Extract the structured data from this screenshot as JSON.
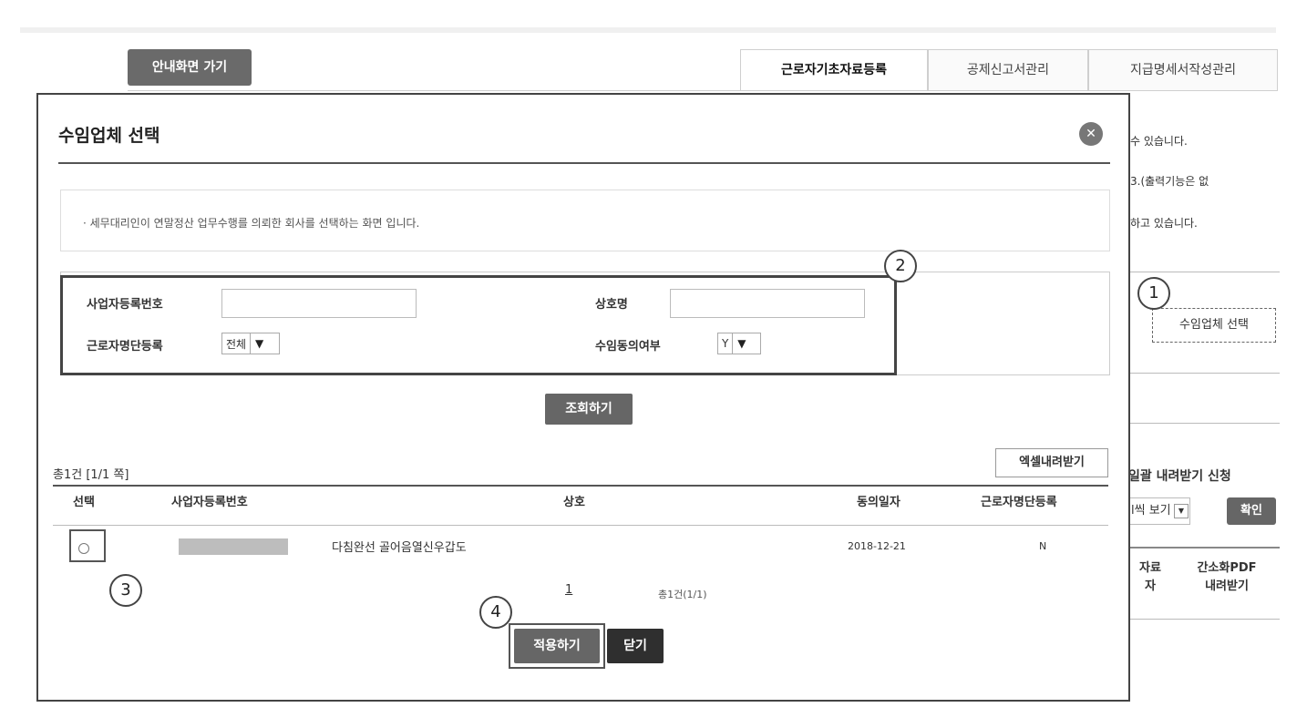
{
  "background": {
    "guide_button": "안내화면 가기",
    "tabs": [
      {
        "label": "근로자기초자료등록"
      },
      {
        "label": "공제신고서관리"
      },
      {
        "label": "지급명세서작성관리"
      }
    ],
    "notes": [
      "수 있습니다.",
      "3.(출력기능은 없",
      "하고 있습니다."
    ],
    "select_client_button": "수임업체 선택",
    "batch_download": "일괄 내려받기 신청",
    "view_select": "l씩 보기",
    "confirm_button": "확인",
    "table_headers": [
      [
        "자료",
        "자"
      ],
      [
        "간소화PDF",
        "내려받기"
      ]
    ]
  },
  "modal": {
    "title": "수임업체 선택",
    "info": "· 세무대리인이 연말정산 업무수행를 의뢰한 회사를 선택하는 화면 입니다.",
    "search": {
      "biz_no_label": "사업자등록번호",
      "biz_no_value": "",
      "company_label": "상호명",
      "company_value": "",
      "worker_list_label": "근로자명단등록",
      "worker_list_value": "전체",
      "consent_label": "수임동의여부",
      "consent_value": "Y"
    },
    "query_button": "조회하기",
    "total_text": "총1건 [1/1 쪽]",
    "excel_button": "엑셀내려받기",
    "columns": [
      "선택",
      "사업자등록번호",
      "상호",
      "동의일자",
      "근로자명단등록"
    ],
    "rows": [
      {
        "company": "다침완선 골어음열신우갑도",
        "consent_date": "2018-12-21",
        "worker_list": "N"
      }
    ],
    "pager": {
      "page": "1",
      "summary": "총1건(1/1)"
    },
    "apply_button": "적용하기",
    "close_button": "닫기"
  },
  "steps": [
    "1",
    "2",
    "3",
    "4"
  ]
}
